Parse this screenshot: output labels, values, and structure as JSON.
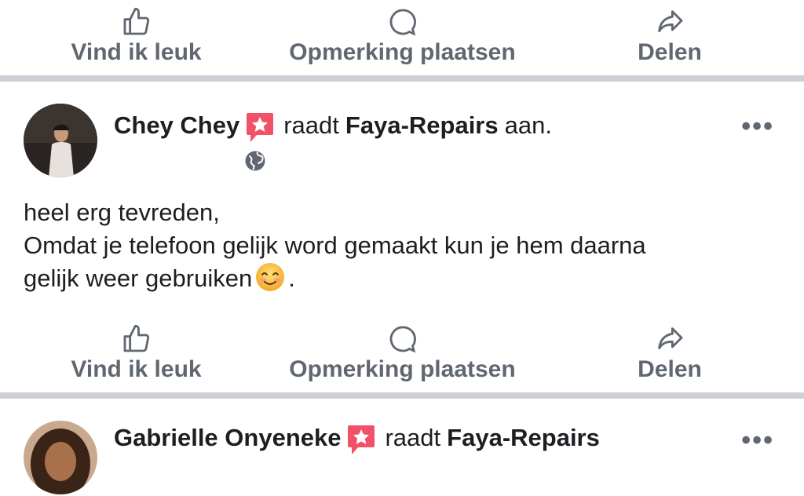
{
  "actions_top": {
    "like_label": "Vind ik leuk",
    "comment_label": "Opmerking plaatsen",
    "share_label": "Delen"
  },
  "post1": {
    "author": "Chey Chey",
    "verb": "raadt",
    "page": "Faya-Repairs",
    "suffix": "aan.",
    "more": "•••",
    "body_line1": "heel erg tevreden,",
    "body_line2": "Omdat je telefoon gelijk word gemaakt kun je hem daarna",
    "body_line3_text": "gelijk weer gebruiken",
    "body_line3_end": ".",
    "emoji": "smiling-face-icon",
    "audience_icon": "globe-icon"
  },
  "actions_post1": {
    "like_label": "Vind ik leuk",
    "comment_label": "Opmerking plaatsen",
    "share_label": "Delen"
  },
  "post2": {
    "author": "Gabrielle Onyeneke",
    "verb": "raadt",
    "page": "Faya-Repairs",
    "more": "•••"
  },
  "colors": {
    "text": "#1c1e21",
    "secondary": "#606770",
    "divider": "#cdd0d4",
    "badge": "#f25268"
  }
}
